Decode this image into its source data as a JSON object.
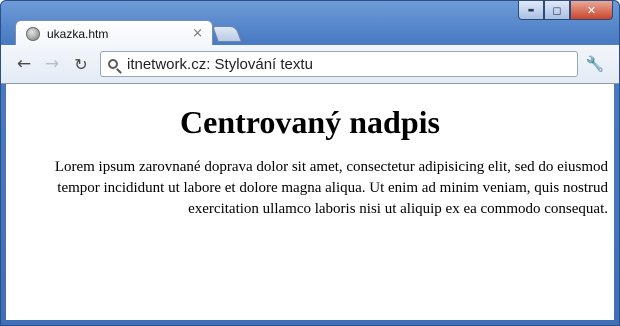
{
  "window": {
    "controls": {
      "minimize": "▬",
      "maximize": "◻",
      "close": "✕"
    }
  },
  "tabs": [
    {
      "title": "ukazka.htm",
      "favicon": "globe-icon",
      "close": "×"
    }
  ],
  "toolbar": {
    "back": "←",
    "forward": "→",
    "reload": "↻",
    "url": "itnetwork.cz: Stylování textu",
    "menu": "🔧"
  },
  "page": {
    "heading": "Centrovaný nadpis",
    "paragraph": "Lorem ipsum zarovnané doprava dolor sit amet, consectetur adipisicing elit, sed do eiusmod tempor incididunt ut labore et dolore magna aliqua. Ut enim ad minim veniam, quis nostrud exercitation ullamco laboris nisi ut aliquip ex ea commodo consequat."
  },
  "colors": {
    "frame": "#4a7cc4",
    "close_button": "#c8452d"
  }
}
